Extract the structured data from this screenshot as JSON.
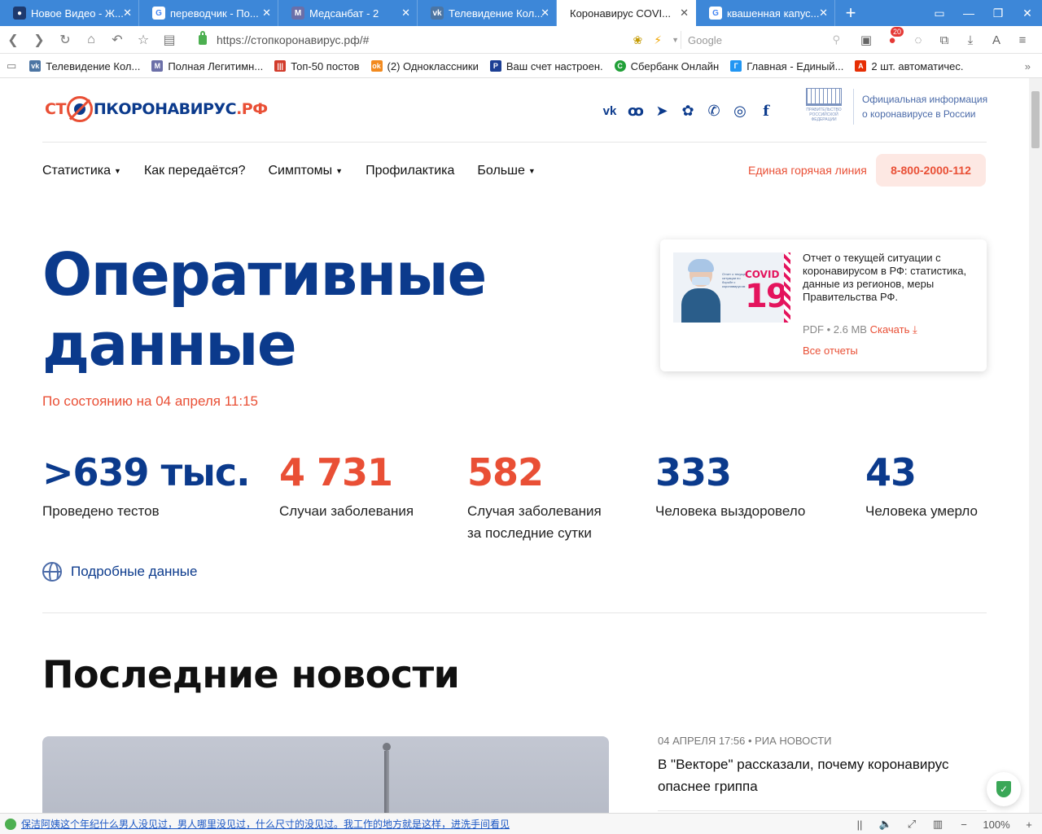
{
  "browser": {
    "tabs": [
      {
        "title": "Новое Видео - Ж...",
        "icon": "user-icon",
        "fav_color": "#1e3a6e",
        "fav_glyph": "👤"
      },
      {
        "title": "переводчик - По...",
        "icon": "google-icon",
        "fav_color": "#ffffff",
        "fav_glyph": "G"
      },
      {
        "title": "Медсанбат - 2",
        "icon": "web-icon",
        "fav_color": "#6b6fa8",
        "fav_glyph": "M"
      },
      {
        "title": "Телевидение Кол...",
        "icon": "vk-icon",
        "fav_color": "#4c75a3",
        "fav_glyph": "vk"
      },
      {
        "title": "Коронавирус COVI...",
        "icon": "none",
        "fav_color": "",
        "fav_glyph": ""
      },
      {
        "title": "квашенная капус...",
        "icon": "google-icon",
        "fav_color": "#ffffff",
        "fav_glyph": "G"
      }
    ],
    "url": "https://стопкоронавирус.рф/#",
    "search_placeholder": "Google",
    "ad_badge_count": "20",
    "bookmarks": [
      {
        "label": "Телевидение Кол...",
        "color": "#4c75a3",
        "glyph": "vk"
      },
      {
        "label": "Полная Легитимн...",
        "color": "#6b6fa8",
        "glyph": "M"
      },
      {
        "label": "Топ-50 постов",
        "color": "#d23c2c",
        "glyph": "|||"
      },
      {
        "label": "(2) Одноклассники",
        "color": "#f28a1f",
        "glyph": "ok"
      },
      {
        "label": "Ваш счет настроен.",
        "color": "#1c3f94",
        "glyph": "P"
      },
      {
        "label": "Сбербанк Онлайн",
        "color": "#21a038",
        "glyph": "С"
      },
      {
        "label": "Главная - Единый...",
        "color": "#2196f3",
        "glyph": "Г"
      },
      {
        "label": "2 шт. автоматичес.",
        "color": "#e62e04",
        "glyph": "A"
      }
    ],
    "status_text": "保洁阿姨这个年纪什么男人没见过，男人哪里没见过，什么尺寸的没见过。我工作的地方就是这样，进洗手间看见",
    "zoom": "100%"
  },
  "site": {
    "logo": {
      "part1": "СТ",
      "part2": "ПКОРОНАВИРУС",
      "part3": ".РФ"
    },
    "gov_emblem_text": "ПРАВИТЕЛЬСТВО РОССИЙСКОЙ ФЕДЕРАЦИИ",
    "gov_info": [
      "Официальная информация",
      "о коронавирусе в России"
    ],
    "menu": [
      {
        "label": "Статистика",
        "has_dropdown": true
      },
      {
        "label": "Как передаётся?",
        "has_dropdown": false
      },
      {
        "label": "Симптомы",
        "has_dropdown": true
      },
      {
        "label": "Профилактика",
        "has_dropdown": false
      },
      {
        "label": "Больше",
        "has_dropdown": true
      }
    ],
    "hotline_label": "Единая горячая линия",
    "hotline_phone": "8-800-2000-112"
  },
  "hero": {
    "title_line1": "Оперативные",
    "title_line2": "данные",
    "as_of": "По состоянию на 04 апреля 11:15"
  },
  "report_card": {
    "thumb_small_text": "Отчет о текущей ситуации по борьбе с коронавирусом",
    "thumb_word": "COVID",
    "thumb_number": "19",
    "description": "Отчет о текущей ситуации с коронавирусом в РФ: статистика, данные из регионов, меры Правительства РФ.",
    "file_meta": "PDF • 2.6 MB",
    "download_label": "Скачать",
    "all_reports_label": "Все отчеты"
  },
  "stats": [
    {
      "value": ">639 тыс.",
      "label_line1": "Проведено тестов",
      "label_line2": "",
      "color": "#0b3a8c"
    },
    {
      "value": "4 731",
      "label_line1": "Случаи заболевания",
      "label_line2": "",
      "color": "#e94f35"
    },
    {
      "value": "582",
      "label_line1": "Случая заболевания",
      "label_line2": "за последние сутки",
      "color": "#e94f35"
    },
    {
      "value": "333",
      "label_line1": "Человека выздоровело",
      "label_line2": "",
      "color": "#0b3a8c"
    },
    {
      "value": "43",
      "label_line1": "Человека умерло",
      "label_line2": "",
      "color": "#0b3a8c"
    }
  ],
  "details_link": "Подробные данные",
  "news": {
    "section_title": "Последние новости",
    "items": [
      {
        "meta": "04 АПРЕЛЯ 17:56 • РИА НОВОСТИ",
        "headline": "В \"Векторе\" рассказали, почему коронавирус опаснее гриппа"
      }
    ]
  },
  "colors": {
    "brand_blue": "#0b3a8c",
    "brand_red": "#e94f35",
    "tab_bar": "#3d87d8"
  }
}
